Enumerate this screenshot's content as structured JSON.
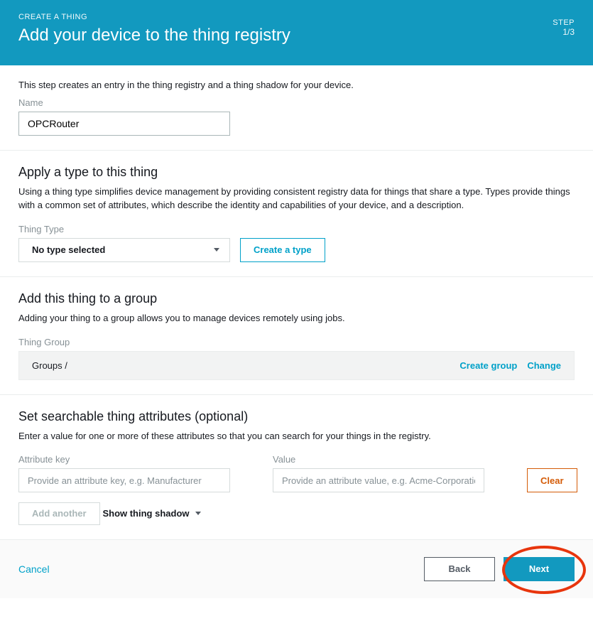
{
  "header": {
    "breadcrumb": "CREATE A THING",
    "title": "Add your device to the thing registry",
    "step_label": "STEP",
    "step_count": "1/3"
  },
  "intro": {
    "text": "This step creates an entry in the thing registry and a thing shadow for your device.",
    "name_label": "Name",
    "name_value": "OPCRouter"
  },
  "type_section": {
    "heading": "Apply a type to this thing",
    "desc": "Using a thing type simplifies device management by providing consistent registry data for things that share a type. Types provide things with a common set of attributes, which describe the identity and capabilities of your device, and a description.",
    "label": "Thing Type",
    "selected": "No type selected",
    "create_button": "Create a type"
  },
  "group_section": {
    "heading": "Add this thing to a group",
    "desc": "Adding your thing to a group allows you to manage devices remotely using jobs.",
    "label": "Thing Group",
    "path": "Groups /",
    "create_group": "Create group",
    "change": "Change"
  },
  "attr_section": {
    "heading": "Set searchable thing attributes (optional)",
    "desc": "Enter a value for one or more of these attributes so that you can search for your things in the registry.",
    "key_label": "Attribute key",
    "value_label": "Value",
    "key_placeholder": "Provide an attribute key, e.g. Manufacturer",
    "value_placeholder": "Provide an attribute value, e.g. Acme-Corporation",
    "clear": "Clear",
    "add_another": "Add another",
    "show_shadow": "Show thing shadow"
  },
  "footer": {
    "cancel": "Cancel",
    "back": "Back",
    "next": "Next"
  }
}
